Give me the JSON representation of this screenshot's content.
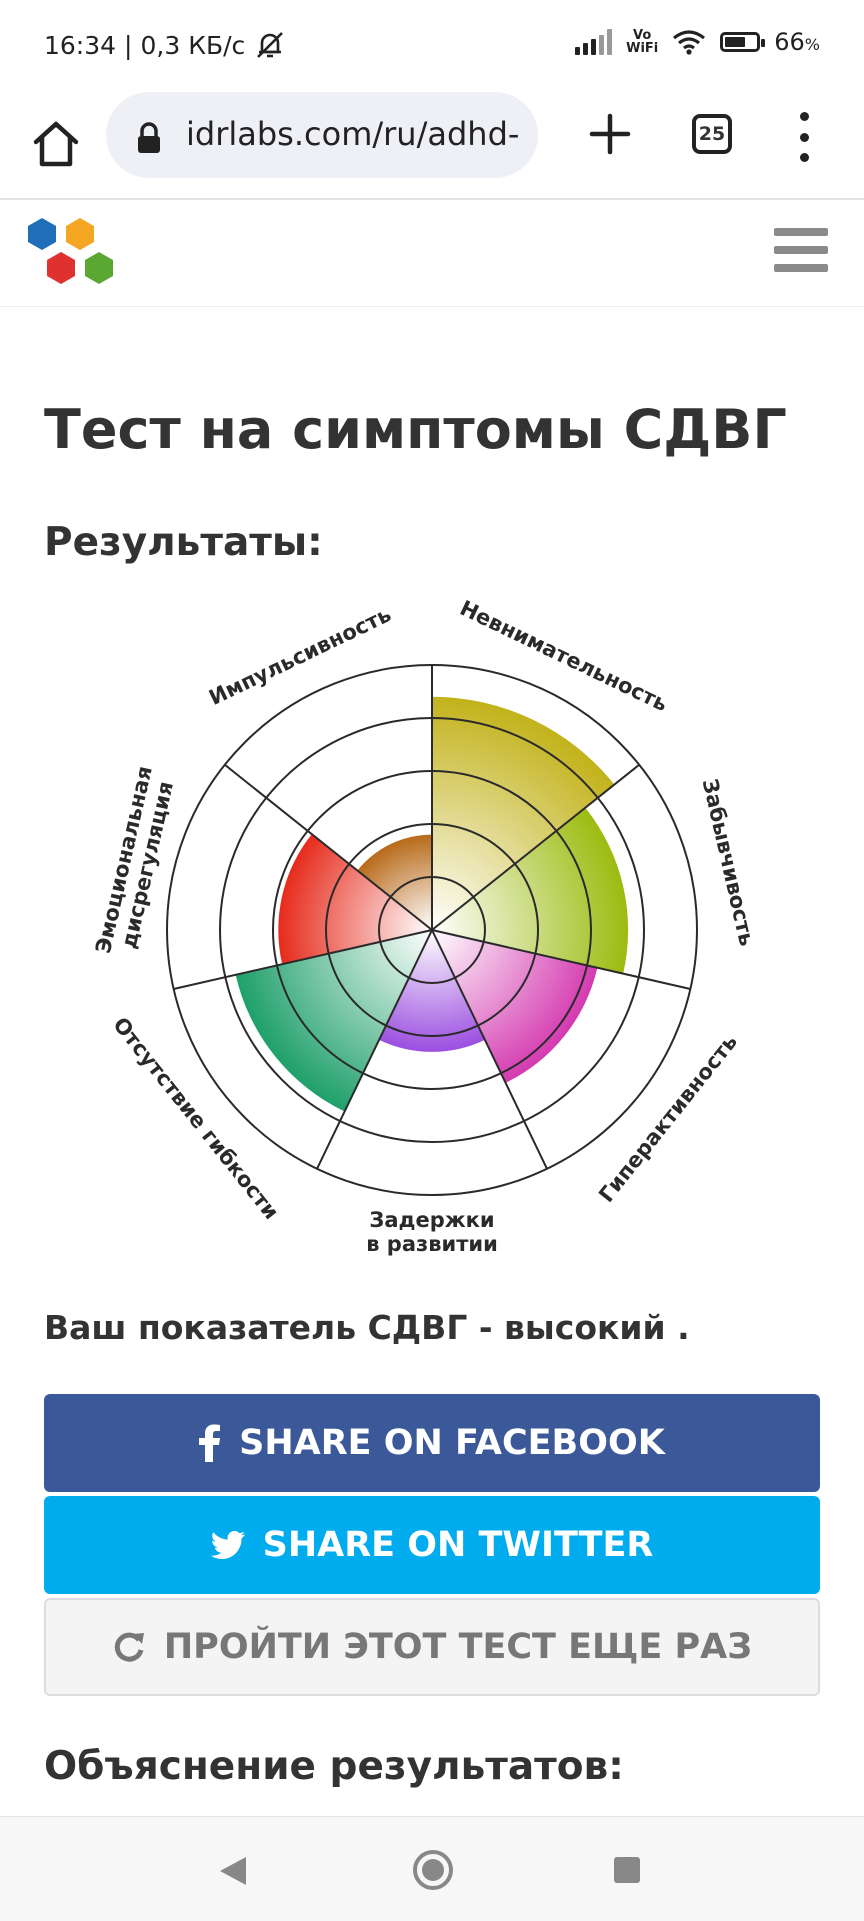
{
  "status_bar": {
    "time": "16:34",
    "separator": "|",
    "net_speed": "0,3 КБ/с",
    "vowifi_top": "Vo",
    "vowifi_bottom": "WiFi",
    "battery_percent": "66",
    "battery_percent_sign": "%",
    "battery_level": 0.66,
    "icons": [
      "bell-muted-icon",
      "signal-icon",
      "wifi-icon",
      "battery-icon"
    ]
  },
  "browser": {
    "url": "idrlabs.com/ru/adhd-",
    "tab_count": "25",
    "icons": [
      "home-icon",
      "lock-icon",
      "plus-icon",
      "tabs-icon",
      "more-vert-icon"
    ]
  },
  "site": {
    "logo_colors": [
      "#1f6fb8",
      "#f5a623",
      "#e03131",
      "#5aa832"
    ]
  },
  "page": {
    "title": "Тест на симптомы СДВГ",
    "results_heading": "Результаты:",
    "score_text": "Ваш показатель СДВГ - высокий .",
    "share_facebook": "SHARE ON FACEBOOK",
    "share_twitter": "SHARE ON TWITTER",
    "retake": "ПРОЙТИ ЭТОТ ТЕСТ ЕЩЕ РАЗ",
    "explanation_heading": "Объяснение результатов:"
  },
  "chart_data": {
    "type": "polar-area",
    "scale_max": 5,
    "grid": true,
    "categories": [
      {
        "lines": [
          "Невнимательность"
        ],
        "value": 4.4,
        "color": "#c2b21a"
      },
      {
        "lines": [
          "Забывчивость"
        ],
        "value": 3.7,
        "color": "#9cbb10"
      },
      {
        "lines": [
          "Гиперактивность"
        ],
        "value": 3.2,
        "color": "#d43ab0"
      },
      {
        "lines": [
          "Задержки",
          "в развитии"
        ],
        "value": 2.3,
        "color": "#9b4fe0"
      },
      {
        "lines": [
          "Отсутствие гибкости"
        ],
        "value": 3.8,
        "color": "#1fa06a"
      },
      {
        "lines": [
          "Эмоциональная",
          "дисрегуляция"
        ],
        "value": 2.9,
        "color": "#e62b1c"
      },
      {
        "lines": [
          "Импульсивность"
        ],
        "value": 1.8,
        "color": "#b86a1a"
      }
    ]
  },
  "colors": {
    "facebook": "#3b5998",
    "twitter": "#00aced",
    "heading_text": "#333333"
  }
}
